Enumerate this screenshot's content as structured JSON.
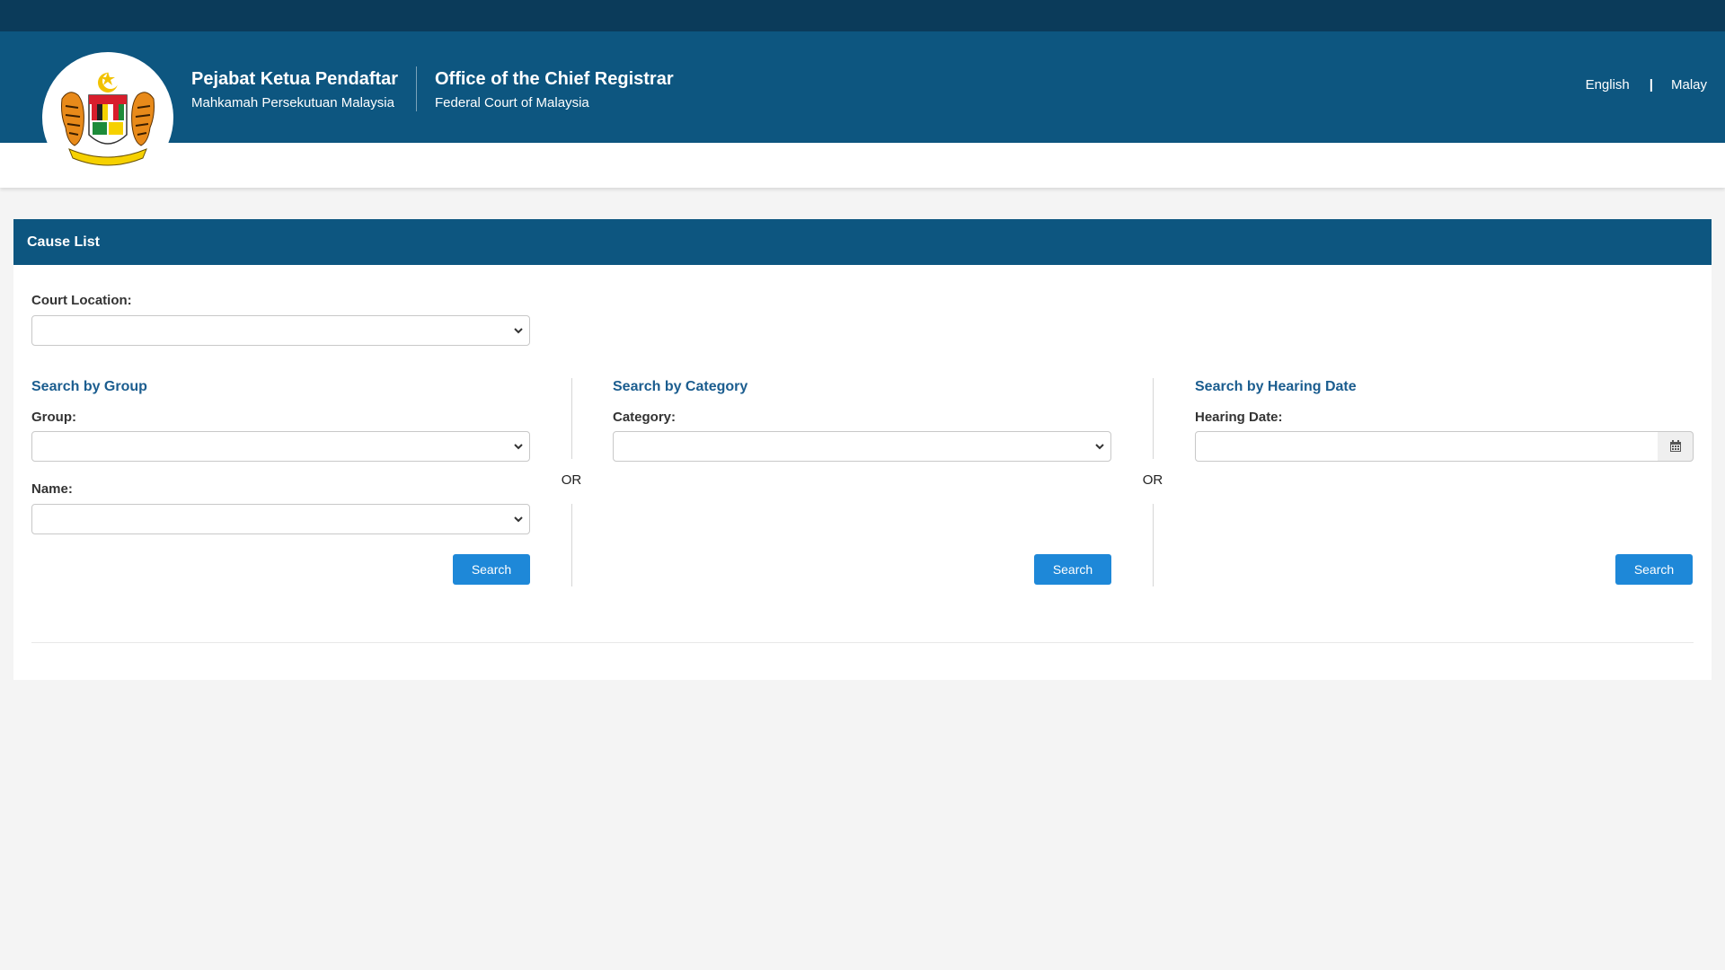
{
  "header": {
    "title_ms": "Pejabat Ketua Pendaftar",
    "subtitle_ms": "Mahkamah Persekutuan Malaysia",
    "title_en": "Office of the Chief Registrar",
    "subtitle_en": "Federal Court of Malaysia",
    "languages": [
      "English",
      "Malay"
    ],
    "lang_separator": "|",
    "logo": "malaysia-coat-of-arms-icon"
  },
  "panel": {
    "heading": "Cause List",
    "court_location_label": "Court Location:",
    "court_location_value": "",
    "or_label": "OR",
    "sections": [
      {
        "title": "Search by Group",
        "fields": [
          {
            "label": "Group:",
            "value": ""
          },
          {
            "label": "Name:",
            "value": ""
          }
        ],
        "button": "Search"
      },
      {
        "title": "Search by Category",
        "fields": [
          {
            "label": "Category:",
            "value": ""
          }
        ],
        "button": "Search"
      },
      {
        "title": "Search by Hearing Date",
        "fields": [
          {
            "label": "Hearing Date:",
            "value": "",
            "icon": "calendar-icon"
          }
        ],
        "button": "Search"
      }
    ]
  },
  "colors": {
    "top_bar": "#0b3b5a",
    "header": "#0d5680",
    "section_title": "#1b5d8f",
    "button": "#1e88d8",
    "background": "#f4f4f4"
  }
}
